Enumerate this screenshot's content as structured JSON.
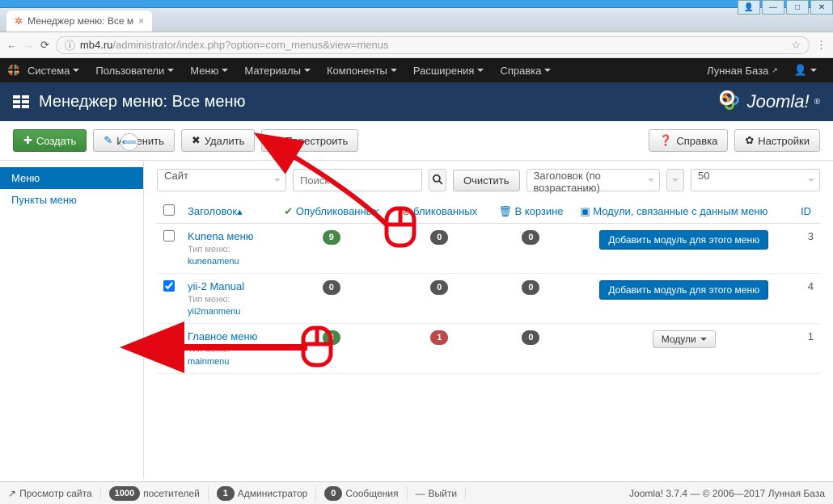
{
  "window": {
    "buttons": [
      "👤",
      "—",
      "□",
      "✕"
    ]
  },
  "browser": {
    "tab_title": "Менеджер меню: Все м",
    "url_host": "mb4.ru",
    "url_path": "/administrator/index.php?option=com_menus&view=menus"
  },
  "topnav": {
    "items": [
      "Система",
      "Пользователи",
      "Меню",
      "Материалы",
      "Компоненты",
      "Расширения",
      "Справка"
    ],
    "site_name": "Лунная База"
  },
  "subheader": {
    "title": "Менеджер меню: Все меню",
    "brand": "Joomla!"
  },
  "toolbar": {
    "create": "Создать",
    "edit": "Изменить",
    "delete": "Удалить",
    "rebuild": "Перестроить",
    "help": "Справка",
    "settings": "Настройки"
  },
  "sidebar": {
    "items": [
      "Меню",
      "Пункты меню"
    ],
    "active_index": 0
  },
  "filters": {
    "client": "Сайт",
    "search_placeholder": "Поиск",
    "clear": "Очистить",
    "sort": "Заголовок (по возрастанию)",
    "limit": "50"
  },
  "table": {
    "headers": {
      "title": "Заголовок",
      "published": "Опубликованных",
      "unpublished": "бликованных",
      "trashed": "В корзине",
      "modules": "Модули, связанные с данным меню",
      "id": "ID"
    },
    "type_label": "Тип меню:",
    "add_module": "Добавить модуль для этого меню",
    "modules_dd": "Модули",
    "rows": [
      {
        "title": "Kunena меню",
        "menutype": "kunenamenu",
        "published": 9,
        "unpublished": 0,
        "trashed": 0,
        "module_btn": "add",
        "id": 3,
        "checked": false
      },
      {
        "title": "yii-2 Manual",
        "menutype": "yii2manmenu",
        "published": 0,
        "unpublished": 0,
        "trashed": 0,
        "module_btn": "add",
        "id": 4,
        "checked": true
      },
      {
        "title": "Главное меню",
        "menutype": "mainmenu",
        "published": 4,
        "unpublished": 1,
        "trashed": 0,
        "module_btn": "dropdown",
        "id": 1,
        "checked": false
      }
    ]
  },
  "statusbar": {
    "preview": "Просмотр сайта",
    "visitors_count": "1000",
    "visitors": "посетителей",
    "admin_count": "1",
    "admin": "Администратор",
    "msg_count": "0",
    "messages": "Сообщения",
    "logout": "Выйти",
    "version": "Joomla! 3.7.4  —  © 2006—2017 Лунная База"
  }
}
